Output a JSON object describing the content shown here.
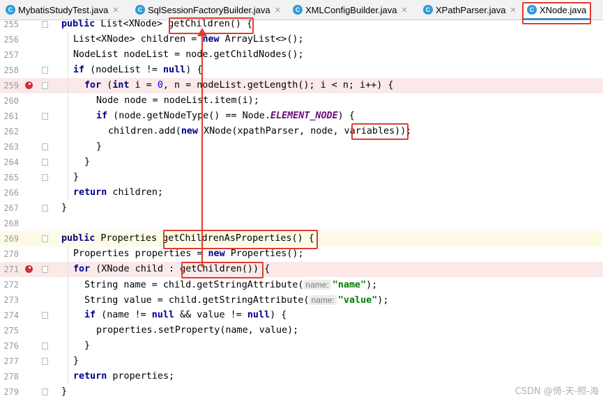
{
  "tabs": [
    {
      "label": "MybatisStudyTest.java",
      "icon": "C",
      "active": false
    },
    {
      "label": "SqlSessionFactoryBuilder.java",
      "icon": "C",
      "active": false
    },
    {
      "label": "XMLConfigBuilder.java",
      "icon": "C",
      "active": false
    },
    {
      "label": "XPathParser.java",
      "icon": "C",
      "active": false
    },
    {
      "label": "XNode.java",
      "icon": "C",
      "active": true
    }
  ],
  "line_numbers": [
    "255",
    "256",
    "257",
    "258",
    "259",
    "260",
    "261",
    "262",
    "263",
    "264",
    "265",
    "266",
    "267",
    "268",
    "269",
    "270",
    "271",
    "272",
    "273",
    "274",
    "275",
    "276",
    "277",
    "278",
    "279"
  ],
  "code": {
    "l255": {
      "a": "public",
      "b": " List<XNode> ",
      "c": "getChildren()",
      "d": " {"
    },
    "l256": {
      "a": "List<XNode> children = ",
      "b": "new",
      "c": " ArrayList<>();"
    },
    "l257": {
      "a": "NodeList nodeList = node.getChildNodes();"
    },
    "l258": {
      "a": "if",
      "b": " (nodeList != ",
      "c": "null",
      "d": ") {"
    },
    "l259": {
      "a": "for",
      "b": " (",
      "c": "int",
      "d": " i = ",
      "e": "0",
      "f": ", n = nodeList.getLength(); i < n; i++) {"
    },
    "l260": {
      "a": "Node node = nodeList.item(i);"
    },
    "l261": {
      "a": "if",
      "b": " (node.getNodeType() == Node.",
      "c": "ELEMENT_NODE",
      "d": ") {"
    },
    "l262": {
      "a": "children.add(",
      "b": "new",
      "c": " XNode(xpathParser, node, ",
      "d": "variables",
      "e": "));"
    },
    "l263": {
      "a": "}"
    },
    "l264": {
      "a": "}"
    },
    "l265": {
      "a": "}"
    },
    "l266": {
      "a": "return",
      "b": " children;"
    },
    "l267": {
      "a": "}"
    },
    "l269": {
      "a": "public",
      "b": " Properties ",
      "c": "getChildrenAsProperties()",
      "d": " {"
    },
    "l270": {
      "a": "Properties properties = ",
      "b": "new",
      "c": " Properties();"
    },
    "l271": {
      "a": "for",
      "b": " (XNode child : ",
      "c": "getChildren()",
      "d": ") {"
    },
    "l272": {
      "a": "String name = child.getStringAttribute(",
      "hint": "name:",
      "s": "\"name\"",
      "e": ");"
    },
    "l273": {
      "a": "String value = child.getStringAttribute(",
      "hint": "name:",
      "s": "\"value\"",
      "e": ");"
    },
    "l274": {
      "a": "if",
      "b": " (name != ",
      "c": "null",
      "d": " && value != ",
      "e": "null",
      "f": ") {"
    },
    "l275": {
      "a": "properties.setProperty(name, value);"
    },
    "l276": {
      "a": "}"
    },
    "l277": {
      "a": "}"
    },
    "l278": {
      "a": "return",
      "b": " properties;"
    },
    "l279": {
      "a": "}"
    }
  },
  "watermark": "CSDN @倚-天-照-海",
  "colors": {
    "annotation": "#e23b2e",
    "keyword": "#00008b",
    "string": "#007a00",
    "breakpoint": "#c8333a",
    "active_tab_underline": "#4a88c7"
  }
}
